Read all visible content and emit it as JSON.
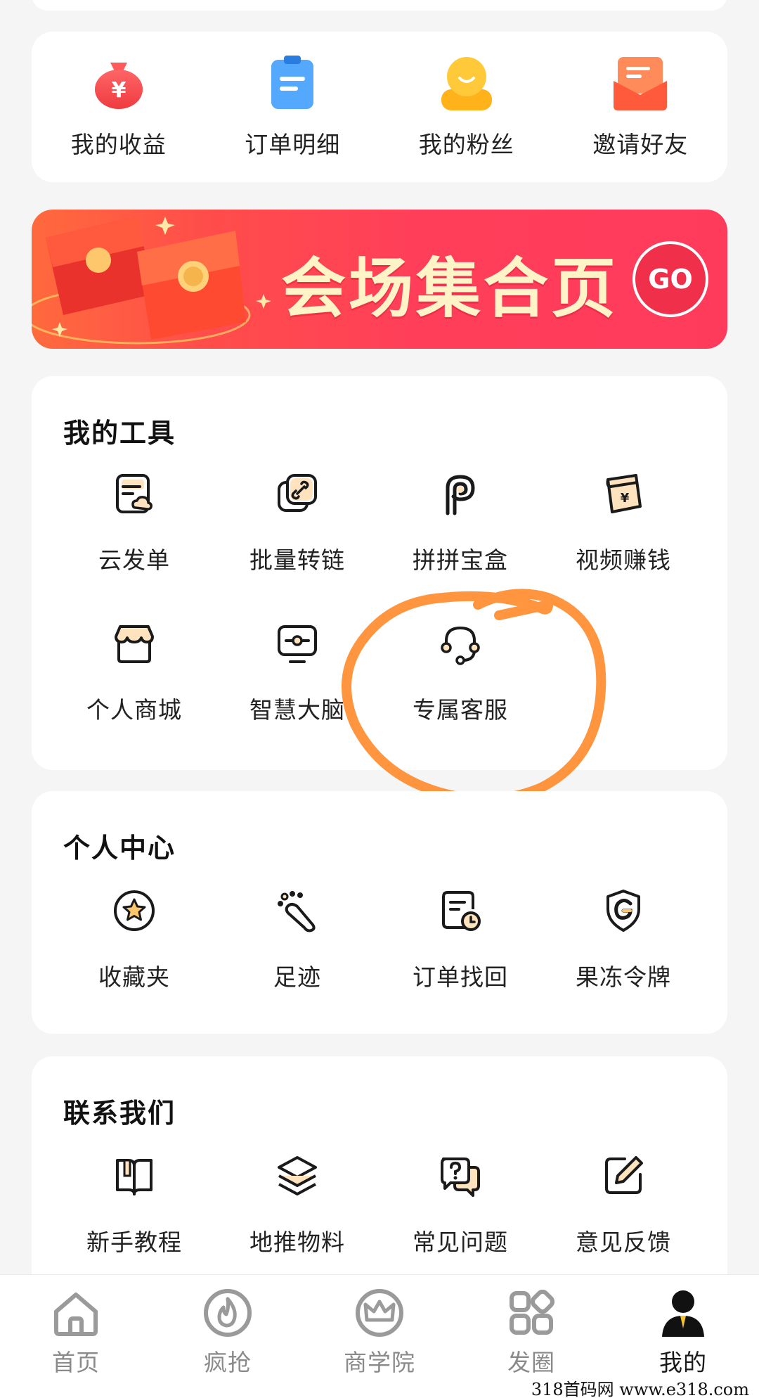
{
  "quick_actions": [
    {
      "label": "我的收益",
      "icon": "money-bag-icon"
    },
    {
      "label": "订单明细",
      "icon": "clipboard-icon"
    },
    {
      "label": "我的粉丝",
      "icon": "user-smile-icon"
    },
    {
      "label": "邀请好友",
      "icon": "envelope-icon"
    }
  ],
  "banner": {
    "title": "会场集合页",
    "button_label": "GO"
  },
  "tools": {
    "title": "我的工具",
    "items": [
      {
        "label": "云发单",
        "icon": "cloud-post-icon"
      },
      {
        "label": "批量转链",
        "icon": "link-convert-icon"
      },
      {
        "label": "拼拼宝盒",
        "icon": "pinpin-icon"
      },
      {
        "label": "视频赚钱",
        "icon": "video-earn-icon"
      },
      {
        "label": "个人商城",
        "icon": "store-icon"
      },
      {
        "label": "智慧大脑",
        "icon": "monitor-icon"
      },
      {
        "label": "专属客服",
        "icon": "headset-icon"
      }
    ]
  },
  "personal": {
    "title": "个人中心",
    "items": [
      {
        "label": "收藏夹",
        "icon": "star-icon"
      },
      {
        "label": "足迹",
        "icon": "footprint-icon"
      },
      {
        "label": "订单找回",
        "icon": "order-clock-icon"
      },
      {
        "label": "果冻令牌",
        "icon": "shield-g-icon"
      }
    ]
  },
  "contact": {
    "title": "联系我们",
    "items": [
      {
        "label": "新手教程",
        "icon": "book-icon"
      },
      {
        "label": "地推物料",
        "icon": "layers-icon"
      },
      {
        "label": "常见问题",
        "icon": "question-chat-icon"
      },
      {
        "label": "意见反馈",
        "icon": "edit-icon"
      }
    ]
  },
  "tabbar": [
    {
      "label": "首页",
      "icon": "home-icon",
      "active": false
    },
    {
      "label": "疯抢",
      "icon": "flame-icon",
      "active": false
    },
    {
      "label": "商学院",
      "icon": "crown-icon",
      "active": false
    },
    {
      "label": "发圈",
      "icon": "grid-icon",
      "active": false
    },
    {
      "label": "我的",
      "icon": "profile-icon",
      "active": true
    }
  ],
  "watermark": "318首码网   www.e318.com",
  "colors": {
    "accent_orange": "#ff8a3d",
    "banner_red": "#ff3b5c",
    "icon_cream": "#ffe8c7",
    "annotation": "#ff8a2a"
  }
}
